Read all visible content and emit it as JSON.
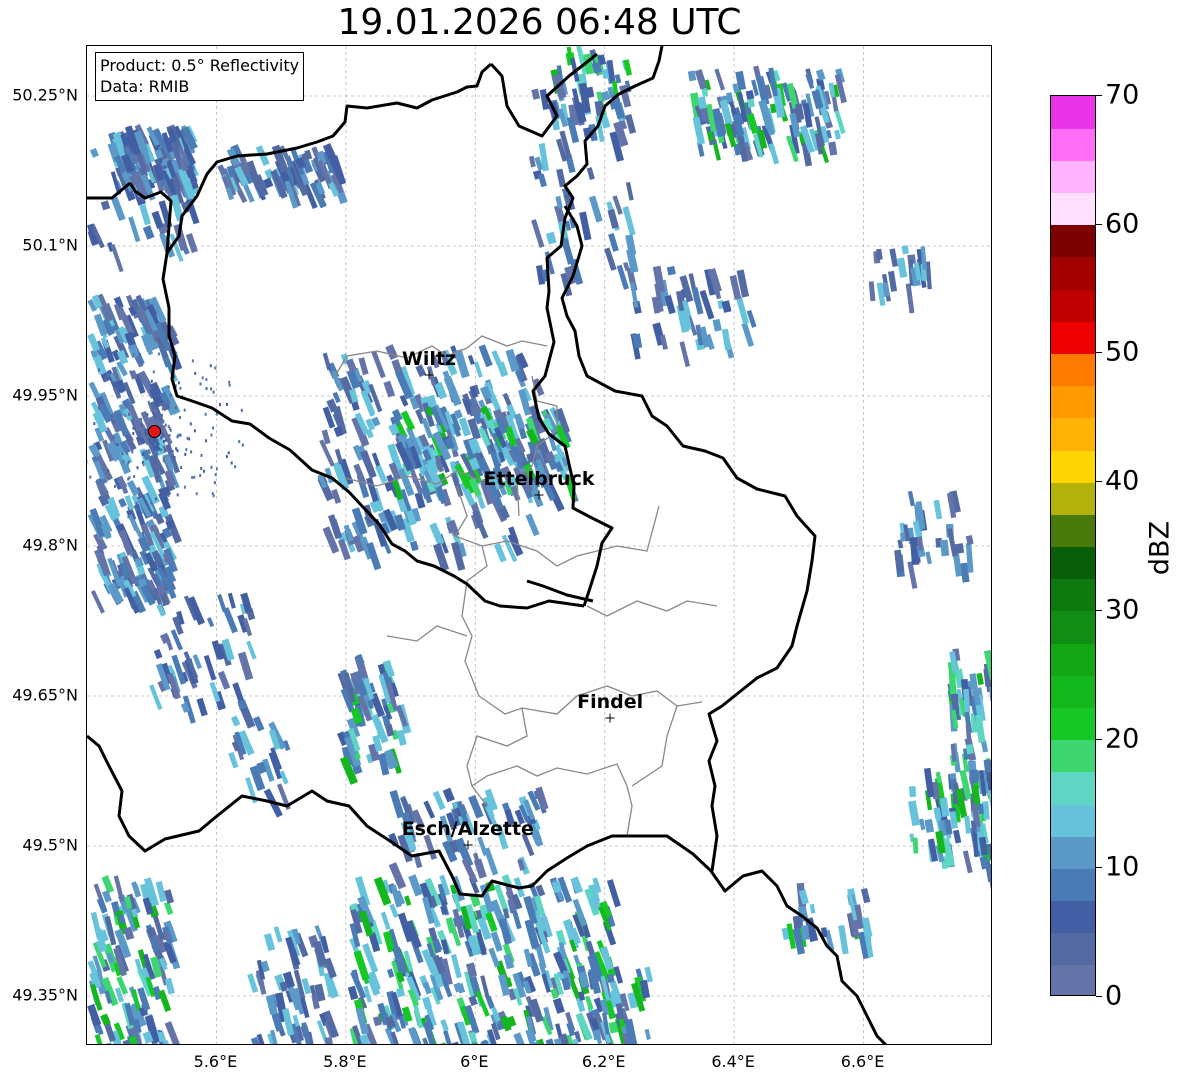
{
  "title": "19.01.2026 06:48 UTC",
  "info": {
    "product": "Product: 0.5° Reflectivity",
    "data": "Data: RMIB"
  },
  "map": {
    "lon_range": [
      5.4,
      6.8
    ],
    "lat_range": [
      49.3,
      50.3
    ],
    "lat_ticks": [
      {
        "value": 50.25,
        "label": "50.25°N"
      },
      {
        "value": 50.1,
        "label": "50.1°N"
      },
      {
        "value": 49.95,
        "label": "49.95°N"
      },
      {
        "value": 49.8,
        "label": "49.8°N"
      },
      {
        "value": 49.65,
        "label": "49.65°N"
      },
      {
        "value": 49.5,
        "label": "49.5°N"
      },
      {
        "value": 49.35,
        "label": "49.35°N"
      }
    ],
    "lon_ticks": [
      {
        "value": 5.6,
        "label": "5.6°E"
      },
      {
        "value": 5.8,
        "label": "5.8°E"
      },
      {
        "value": 6.0,
        "label": "6°E"
      },
      {
        "value": 6.2,
        "label": "6.2°E"
      },
      {
        "value": 6.4,
        "label": "6.4°E"
      },
      {
        "value": 6.6,
        "label": "6.6°E"
      }
    ],
    "cities": [
      {
        "name": "Wiltz",
        "lon": 5.93,
        "lat": 49.97
      },
      {
        "name": "Ettelbruck",
        "lon": 6.1,
        "lat": 49.85
      },
      {
        "name": "Findel",
        "lon": 6.21,
        "lat": 49.627
      },
      {
        "name": "Esch/Alzette",
        "lon": 5.99,
        "lat": 49.5
      }
    ],
    "radar_site": {
      "lon": 5.505,
      "lat": 49.914,
      "color": "#e51515"
    },
    "grid": true
  },
  "colorbar": {
    "unit": "dBZ",
    "min": 0,
    "max": 70,
    "step": 2.5,
    "colors": [
      "#6574a8",
      "#536aa3",
      "#435fa4",
      "#4a7bb4",
      "#5b9ac8",
      "#67c3dc",
      "#5fd6c4",
      "#3ed671",
      "#15c826",
      "#14b61d",
      "#12a615",
      "#118c14",
      "#0d7a10",
      "#0a5e0a",
      "#497a0b",
      "#b2b20a",
      "#ffd500",
      "#ffb405",
      "#ff9a00",
      "#ff7b00",
      "#ee0000",
      "#c00000",
      "#a30000",
      "#7d0000",
      "#ffe0ff",
      "#ffb4ff",
      "#ff6ef5",
      "#ea34ea"
    ],
    "ticks": [
      {
        "value": 0,
        "label": "0"
      },
      {
        "value": 10,
        "label": "10"
      },
      {
        "value": 20,
        "label": "20"
      },
      {
        "value": 30,
        "label": "30"
      },
      {
        "value": 40,
        "label": "40"
      },
      {
        "value": 50,
        "label": "50"
      },
      {
        "value": 60,
        "label": "60"
      },
      {
        "value": 70,
        "label": "70"
      }
    ]
  }
}
